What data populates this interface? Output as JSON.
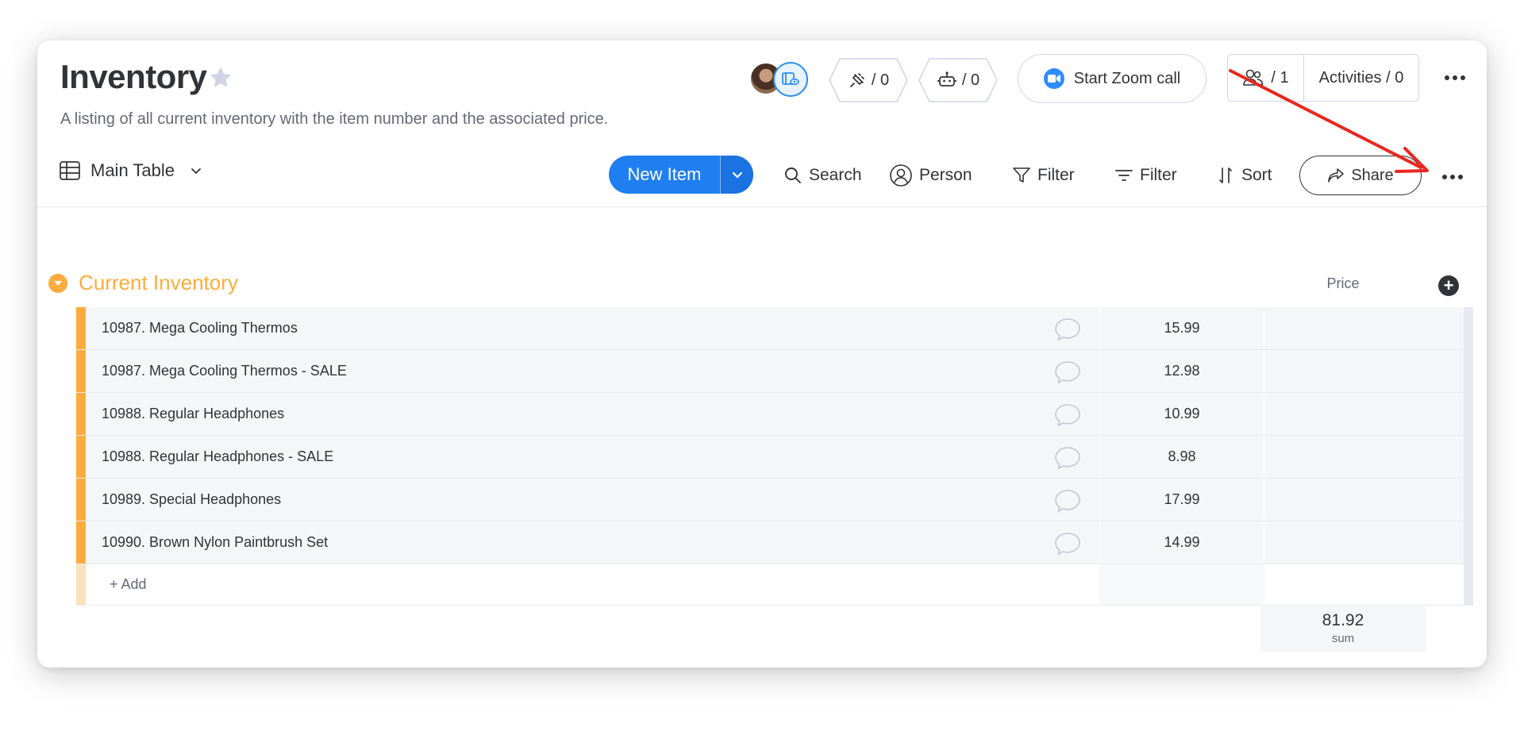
{
  "board": {
    "title": "Inventory",
    "description": "A listing of all current inventory with the item number and the associated price."
  },
  "header": {
    "integrations_count": "/ 0",
    "automations_count": "/ 0",
    "zoom_label": "Start Zoom call",
    "members_count": "/ 1",
    "activities_label": "Activities / 0"
  },
  "toolbar": {
    "view_label": "Main Table",
    "new_item_label": "New Item",
    "search_label": "Search",
    "person_label": "Person",
    "filter1_label": "Filter",
    "filter2_label": "Filter",
    "sort_label": "Sort",
    "share_label": "Share"
  },
  "group": {
    "name": "Current Inventory",
    "color": "#fdab3d",
    "price_column": "Price",
    "items": [
      {
        "name": "10987. Mega Cooling Thermos",
        "price": "15.99"
      },
      {
        "name": "10987. Mega Cooling Thermos - SALE",
        "price": "12.98"
      },
      {
        "name": "10988. Regular Headphones",
        "price": "10.99"
      },
      {
        "name": "10988. Regular Headphones - SALE",
        "price": "8.98"
      },
      {
        "name": "10989. Special Headphones",
        "price": "17.99"
      },
      {
        "name": "10990. Brown Nylon Paintbrush Set",
        "price": "14.99"
      }
    ],
    "add_label": "+ Add",
    "sum_value": "81.92",
    "sum_label": "sum"
  },
  "colors": {
    "accent": "#1f7ff0",
    "annotation_arrow": "#e8281e"
  }
}
